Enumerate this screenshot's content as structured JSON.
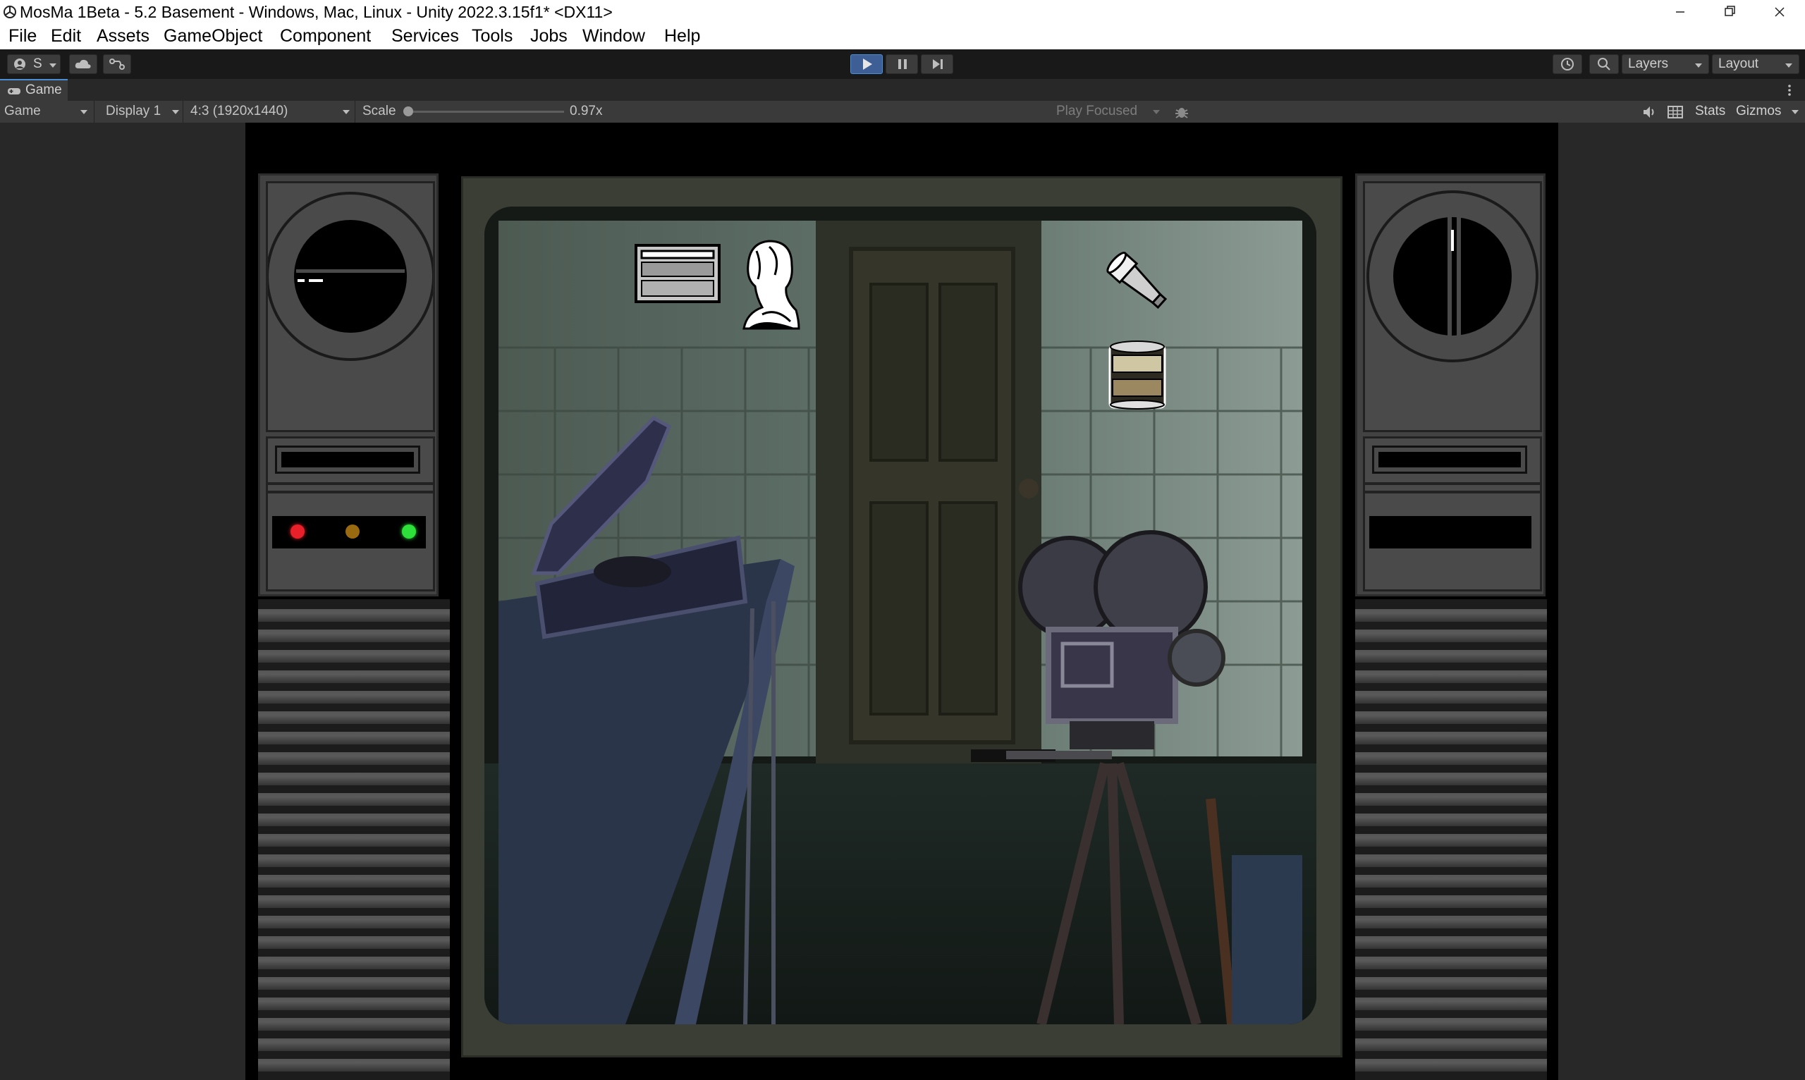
{
  "window": {
    "title": "MosMa 1Beta - 5.2 Basement - Windows, Mac, Linux - Unity 2022.3.15f1* <DX11>",
    "controls": [
      "minimize-icon",
      "restore-icon",
      "close-icon"
    ]
  },
  "menu": {
    "items": [
      "File",
      "Edit",
      "Assets",
      "GameObject",
      "Component",
      "Services",
      "Tools",
      "Jobs",
      "Window",
      "Help"
    ]
  },
  "toolbar": {
    "account_label": "S",
    "icons": [
      "account-icon",
      "cloud-icon",
      "version-control-icon",
      "play-icon",
      "pause-icon",
      "step-icon",
      "history-icon",
      "search-icon"
    ],
    "layers_label": "Layers",
    "layout_label": "Layout"
  },
  "game_tab": {
    "label": "Game"
  },
  "game_toolbar": {
    "view_select": "Game",
    "display_select": "Display 1",
    "aspect_select": "4:3 (1920x1440)",
    "scale_label": "Scale",
    "scale_value": "0.97x",
    "scale_fraction": 0.0,
    "play_focused": "Play Focused",
    "stats_label": "Stats",
    "gizmos_label": "Gizmos"
  },
  "scene": {
    "inventory_items": [
      "cassette-icon",
      "bust-icon",
      "flashlight-icon",
      "film-canister-icon"
    ],
    "left_indicator_lights": [
      "#e8202a",
      "#9a6a10",
      "#2ee03a"
    ],
    "accent": "#4a8fd6"
  }
}
